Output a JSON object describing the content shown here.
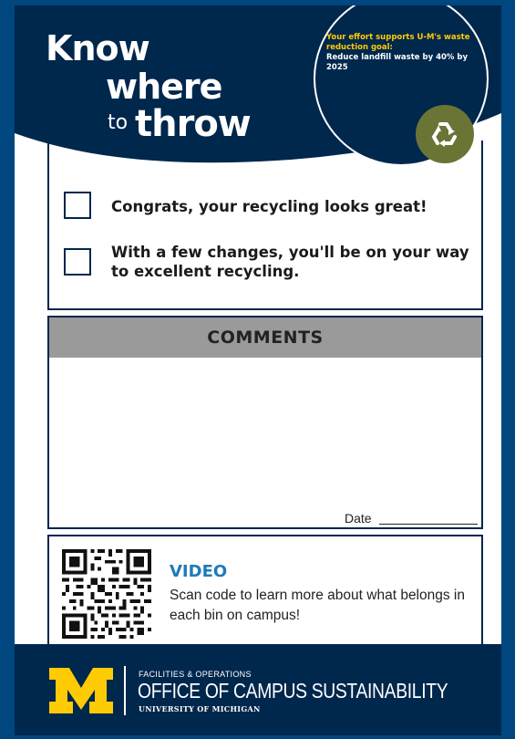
{
  "header": {
    "title_line1": "Know",
    "title_line2": "where",
    "title_line3_small": "to",
    "title_line3_big": "throw",
    "goal_intro": "Your effort supports U-M's waste reduction goal:",
    "goal_detail": "Reduce landfill waste by 40% by 2025",
    "badge_icon": "recycle-icon"
  },
  "checklist": {
    "option1": "Congrats, your recycling looks great!",
    "option2": "With a few changes, you'll be on your way to excellent recycling."
  },
  "comments": {
    "heading": "COMMENTS",
    "date_label": "Date"
  },
  "video": {
    "title": "VIDEO",
    "description": "Scan code to learn more about what belongs in each bin on campus!",
    "qr_icon": "qr-code-icon"
  },
  "footer": {
    "division": "FACILITIES & OPERATIONS",
    "office": "OFFICE OF CAMPUS SUSTAINABILITY",
    "university": "UNIVERSITY OF MICHIGAN",
    "logo_icon": "block-m-logo"
  },
  "colors": {
    "navy": "#00274c",
    "blue_border": "#00467f",
    "maize": "#ffcb05",
    "olive": "#6a7535",
    "video_blue": "#1f7ab8",
    "comments_gray": "#9a9a9a"
  }
}
